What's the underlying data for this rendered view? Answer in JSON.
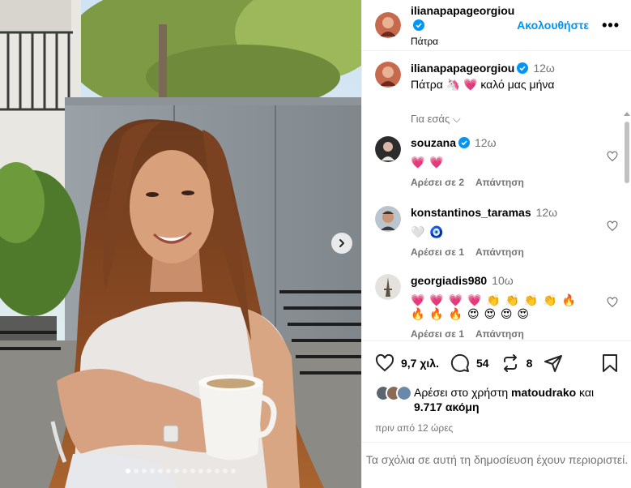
{
  "post": {
    "author": "ilianapapageorgiou",
    "location": "Πάτρα",
    "follow_label": "Ακολουθήστε",
    "more_label": "•••",
    "carousel_total": 14,
    "carousel_active": 1
  },
  "caption": {
    "user": "ilianapapageorgiou",
    "time": "12ω",
    "text": "Πάτρα 🦄 💗 καλό μας μήνα",
    "see_translation": "Για εσάς ⌵"
  },
  "comments": [
    {
      "user": "souzana",
      "verified": true,
      "time": "12ω",
      "text": "💗 💗",
      "likes": "Αρέσει σε 2",
      "reply": "Απάντηση"
    },
    {
      "user": "konstantinos_taramas",
      "verified": false,
      "time": "12ω",
      "text": "🤍 🧿",
      "likes": "Αρέσει σε 1",
      "reply": "Απάντηση"
    },
    {
      "user": "georgiadis980",
      "verified": false,
      "time": "10ω",
      "text": "💗 💗 💗 💗 👏 👏 👏 👏 🔥 🔥 🔥 🔥 😍 😍 😍 😍",
      "likes": "Αρέσει σε 1",
      "reply": "Απάντηση"
    }
  ],
  "actions": {
    "likes_count": "9,7 χιλ.",
    "comments_count": "54",
    "reposts_count": "8"
  },
  "liked_by": {
    "prefix": "Αρέσει στο χρήστη",
    "user": "matoudrako",
    "joiner": "και",
    "others": "9.717 ακόμη"
  },
  "posted_ago": "πριν από 12 ώρες",
  "comments_closed": "Τα σχόλια σε αυτή τη δημοσίευση έχουν περιοριστεί.",
  "colors": {
    "accent": "#0095f6",
    "verified": "#0095f6",
    "muted": "#737373"
  }
}
